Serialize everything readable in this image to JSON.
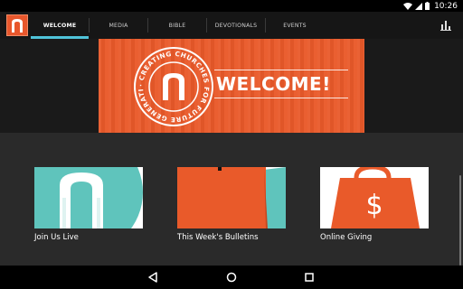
{
  "status_bar": {
    "time": "10:26",
    "icons": [
      "wifi-icon",
      "signal-icon",
      "battery-icon"
    ]
  },
  "app_bar": {
    "logo": "app-logo-arch-icon",
    "tabs": [
      {
        "label": "WELCOME",
        "active": true
      },
      {
        "label": "MEDIA",
        "active": false
      },
      {
        "label": "BIBLE",
        "active": false
      },
      {
        "label": "DEVOTIONALS",
        "active": false
      },
      {
        "label": "EVENTS",
        "active": false
      }
    ],
    "action_icon": "bar-chart-icon"
  },
  "hero": {
    "title": "WELCOME!",
    "seal_text": "· CREATING CHURCHES FOR FUTURE GENERATIONS ·"
  },
  "cards": [
    {
      "label": "Join Us Live",
      "icon": "arch-icon"
    },
    {
      "label": "This Week's Bulletins",
      "icon": "bulletin-icon"
    },
    {
      "label": "Online Giving",
      "icon": "dollar-bag-icon"
    }
  ],
  "nav_bar": {
    "icons": [
      "back-icon",
      "home-icon",
      "recents-icon"
    ]
  },
  "colors": {
    "accent": "#4fc3d9",
    "brand_orange": "#e95a2a",
    "teal": "#5fc4bc"
  }
}
